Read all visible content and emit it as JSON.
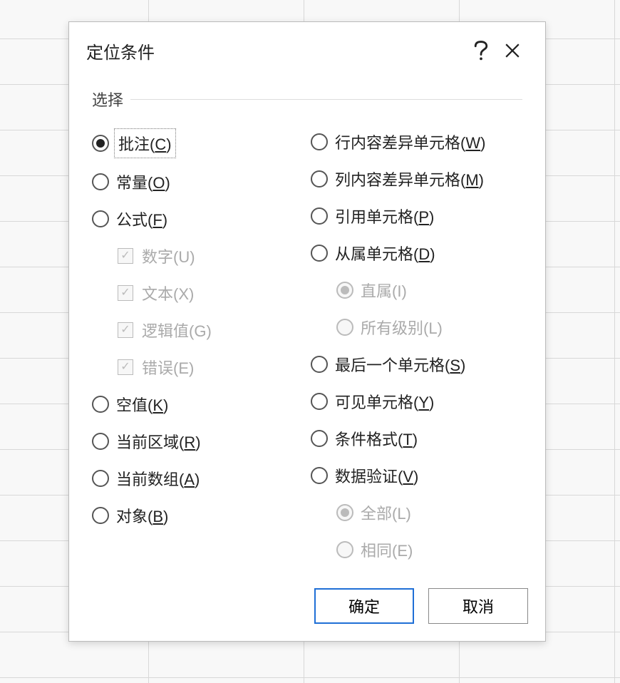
{
  "dialog": {
    "title": "定位条件",
    "section_label": "选择",
    "selected": "comments",
    "buttons": {
      "ok": "确定",
      "cancel": "取消"
    }
  },
  "left_options": [
    {
      "id": "comments",
      "type": "radio",
      "label": "批注",
      "accel": "C",
      "focused": true
    },
    {
      "id": "constants",
      "type": "radio",
      "label": "常量",
      "accel": "O"
    },
    {
      "id": "formulas",
      "type": "radio",
      "label": "公式",
      "accel": "F"
    },
    {
      "id": "numbers",
      "type": "checkbox",
      "label": "数字(U)",
      "indent": true,
      "checked": true,
      "disabled": true
    },
    {
      "id": "text",
      "type": "checkbox",
      "label": "文本(X)",
      "indent": true,
      "checked": true,
      "disabled": true
    },
    {
      "id": "logicals",
      "type": "checkbox",
      "label": "逻辑值(G)",
      "indent": true,
      "checked": true,
      "disabled": true
    },
    {
      "id": "errors",
      "type": "checkbox",
      "label": "错误(E)",
      "indent": true,
      "checked": true,
      "disabled": true
    },
    {
      "id": "blanks",
      "type": "radio",
      "label": "空值",
      "accel": "K"
    },
    {
      "id": "current-region",
      "type": "radio",
      "label": "当前区域",
      "accel": "R"
    },
    {
      "id": "current-array",
      "type": "radio",
      "label": "当前数组",
      "accel": "A"
    },
    {
      "id": "objects",
      "type": "radio",
      "label": "对象",
      "accel": "B"
    }
  ],
  "right_options": [
    {
      "id": "row-diff",
      "type": "radio",
      "label": "行内容差异单元格",
      "accel": "W"
    },
    {
      "id": "col-diff",
      "type": "radio",
      "label": "列内容差异单元格",
      "accel": "M"
    },
    {
      "id": "precedents",
      "type": "radio",
      "label": "引用单元格",
      "accel": "P"
    },
    {
      "id": "dependents",
      "type": "radio",
      "label": "从属单元格",
      "accel": "D"
    },
    {
      "id": "direct",
      "type": "radio",
      "label": "直属(I)",
      "indent": true,
      "sub": true,
      "checked": true,
      "disabled": true
    },
    {
      "id": "all-levels",
      "type": "radio",
      "label": "所有级别(L)",
      "indent": true,
      "sub": true,
      "disabled": true
    },
    {
      "id": "last-cell",
      "type": "radio",
      "label": "最后一个单元格",
      "accel": "S"
    },
    {
      "id": "visible",
      "type": "radio",
      "label": "可见单元格",
      "accel": "Y"
    },
    {
      "id": "cond-format",
      "type": "radio",
      "label": "条件格式",
      "accel": "T"
    },
    {
      "id": "data-validation",
      "type": "radio",
      "label": "数据验证",
      "accel": "V"
    },
    {
      "id": "dv-all",
      "type": "radio",
      "label": "全部(L)",
      "indent": true,
      "sub": true,
      "checked": true,
      "disabled": true
    },
    {
      "id": "dv-same",
      "type": "radio",
      "label": "相同(E)",
      "indent": true,
      "sub": true,
      "disabled": true
    }
  ]
}
